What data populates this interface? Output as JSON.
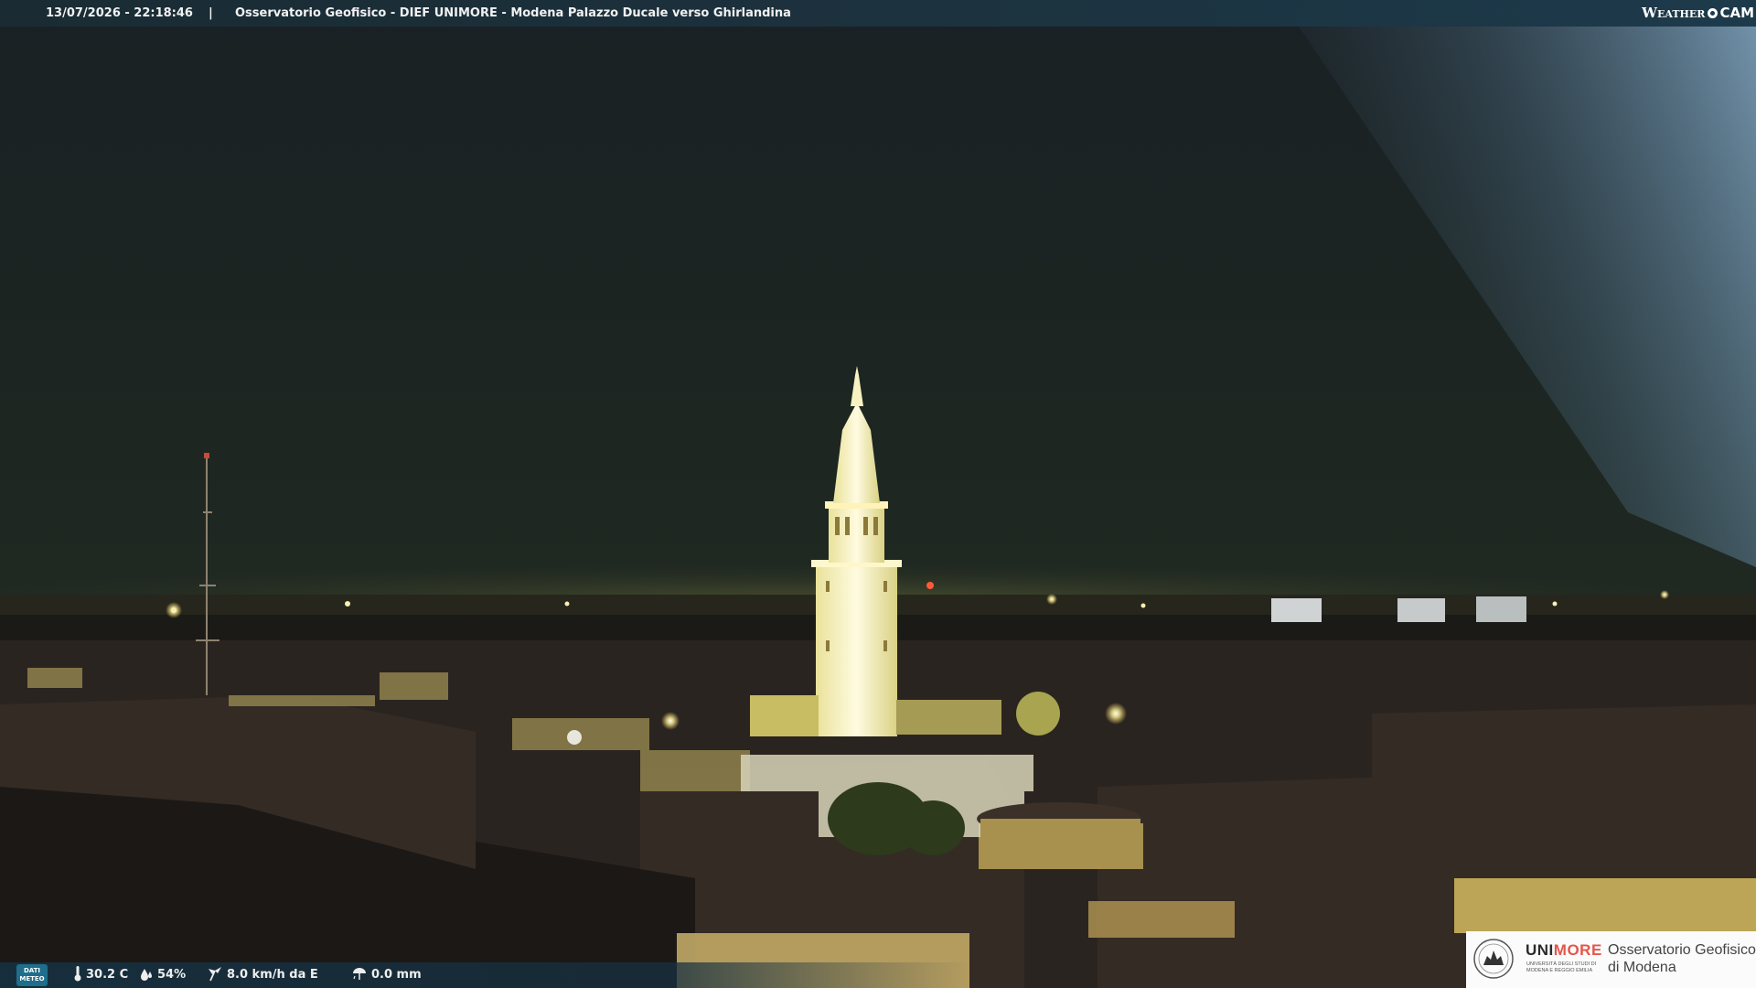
{
  "overlay": {
    "datetime": "13/07/2026 - 22:18:46",
    "separator": "|",
    "title": "Osservatorio Geofisico - DIEF UNIMORE - Modena Palazzo Ducale verso Ghirlandina"
  },
  "brand": {
    "weather": "Weather",
    "cam": "CAM"
  },
  "weather": {
    "badge_line1": "DATI",
    "badge_line2": "METEO",
    "temperature": "30.2 C",
    "humidity": "54%",
    "wind": "8.0 km/h da E",
    "rain": "0.0 mm",
    "icons": [
      "thermometer-icon",
      "humidity-drop-icon",
      "wind-icon",
      "rain-icon"
    ]
  },
  "logo": {
    "uni": "UNI",
    "more": "MORE",
    "university_line": "Università degli studi di Modena e Reggio Emilia",
    "observatory_line1": "Osservatorio Geofisico",
    "observatory_line2": "di Modena"
  },
  "colors": {
    "sky": "#1c2621",
    "tower_light": "#fff8c8",
    "bar": "#1c3340",
    "unimore_accent": "#e2574c"
  }
}
